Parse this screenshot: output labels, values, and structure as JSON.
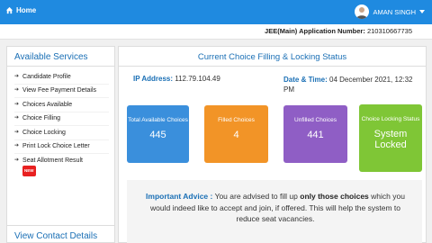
{
  "topbar": {
    "home_label": "Home",
    "user_name": "AMAN SINGH",
    "icons": {
      "home": "home-icon",
      "user": "user-avatar-icon",
      "dropdown": "caret-down-icon"
    },
    "bg_color": "#1f8ae0"
  },
  "application": {
    "label": "JEE(Main) Application Number:",
    "number": "210310667735"
  },
  "sidebar": {
    "title": "Available Services",
    "items": [
      {
        "label": "Candidate Profile"
      },
      {
        "label": "View Fee Payment Details"
      },
      {
        "label": "Choices Available"
      },
      {
        "label": "Choice Filling"
      },
      {
        "label": "Choice Locking"
      },
      {
        "label": "Print Lock Choice Letter"
      },
      {
        "label": "Seat Allotment Result",
        "badge": "NEW"
      }
    ],
    "contact_title": "View Contact Details"
  },
  "main": {
    "title": "Current Choice Filling & Locking Status",
    "ip_label": "IP Address:",
    "ip_value": "112.79.104.49",
    "datetime_label": "Date & Time:",
    "datetime_value": "04 December 2021, 12:32 PM",
    "cards": [
      {
        "label": "Total Available Choices",
        "value": "445",
        "color": "#3a8fdc"
      },
      {
        "label": "Filled Choices",
        "value": "4",
        "color": "#f29427"
      },
      {
        "label": "Unfilled Choices",
        "value": "441",
        "color": "#8f5ec5"
      },
      {
        "label": "Choice Locking Status",
        "value": "System Locked",
        "color": "#7fc636"
      }
    ],
    "advice": {
      "label": "Important Advice :",
      "text_before": "You are advised to fill up",
      "emphasis": "only those choices",
      "text_after": "which you would indeed like to accept and join, if offered. This will help the system to reduce seat vacancies."
    }
  }
}
